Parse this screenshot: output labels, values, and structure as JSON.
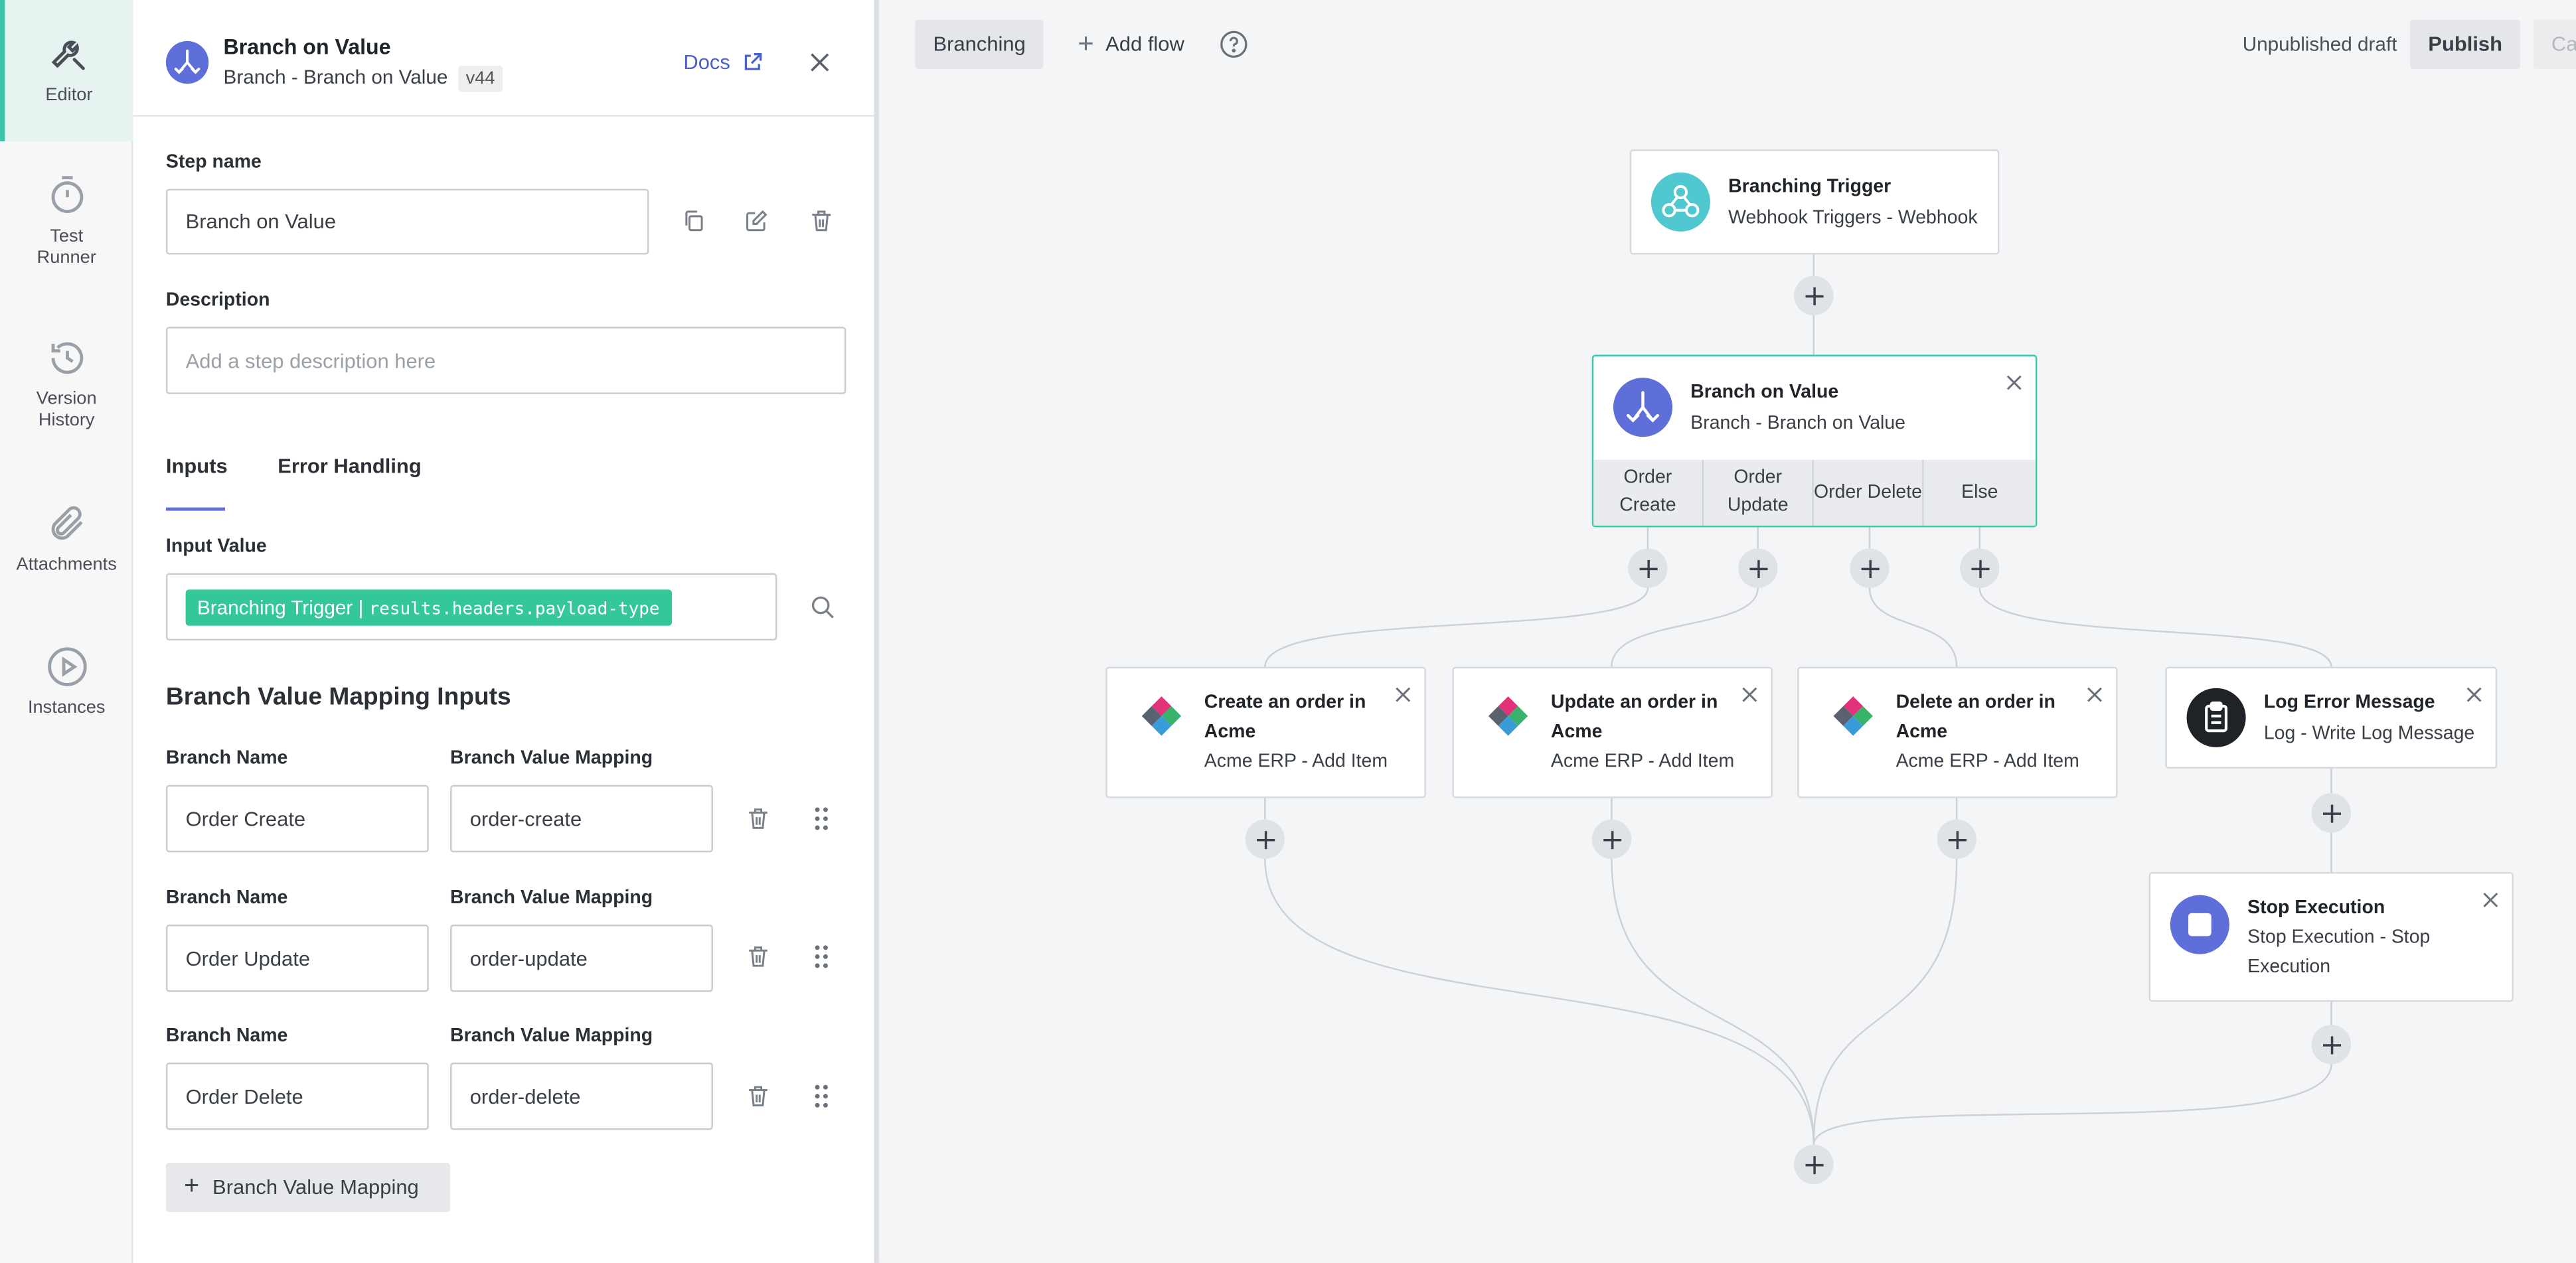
{
  "rail": {
    "items": [
      {
        "label": "Editor",
        "icon": "wrench-icon",
        "active": true
      },
      {
        "label": "Test Runner",
        "icon": "stopwatch-icon"
      },
      {
        "label": "Version History",
        "icon": "history-icon"
      },
      {
        "label": "Attachments",
        "icon": "paperclip-icon"
      },
      {
        "label": "Instances",
        "icon": "play-circle-icon"
      }
    ]
  },
  "panel": {
    "header": {
      "title": "Branch on Value",
      "subtitle": "Branch - Branch on Value",
      "version": "v44",
      "docs_label": "Docs"
    },
    "step_name_label": "Step name",
    "step_name_value": "Branch on Value",
    "description_label": "Description",
    "description_placeholder": "Add a step description here",
    "tabs": [
      "Inputs",
      "Error Handling"
    ],
    "input_value_label": "Input Value",
    "input_value_pill_source": "Branching Trigger",
    "input_value_pill_path": "results.headers.payload-type",
    "mapping_section_title": "Branch Value Mapping Inputs",
    "branch_name_label": "Branch Name",
    "branch_value_label": "Branch Value Mapping",
    "mappings": [
      {
        "name": "Order Create",
        "value": "order-create"
      },
      {
        "name": "Order Update",
        "value": "order-update"
      },
      {
        "name": "Order Delete",
        "value": "order-delete"
      }
    ],
    "add_mapping_label": "Branch Value Mapping"
  },
  "canvas": {
    "flow_tab": "Branching",
    "add_flow_label": "Add flow",
    "status_text": "Unpublished draft",
    "publish_label": "Publish",
    "cancel_label_partial": "Ca",
    "colors": {
      "accent": "#3cc5a8",
      "brand": "#5f6fd9",
      "pill": "#34c79a"
    },
    "nodes": {
      "trigger": {
        "title": "Branching Trigger",
        "subtitle": "Webhook Triggers - Webhook"
      },
      "branch": {
        "title": "Branch on Value",
        "subtitle": "Branch - Branch on Value",
        "branches": [
          "Order Create",
          "Order Update",
          "Order Delete",
          "Else"
        ]
      },
      "create": {
        "title": "Create an order in Acme",
        "subtitle": "Acme ERP - Add Item"
      },
      "update": {
        "title": "Update an order in Acme",
        "subtitle": "Acme ERP - Add Item"
      },
      "delete": {
        "title": "Delete an order in Acme",
        "subtitle": "Acme ERP - Add Item"
      },
      "log": {
        "title": "Log Error Message",
        "subtitle": "Log - Write Log Message"
      },
      "stop": {
        "title": "Stop Execution",
        "subtitle": "Stop Execution - Stop Execution"
      }
    }
  }
}
